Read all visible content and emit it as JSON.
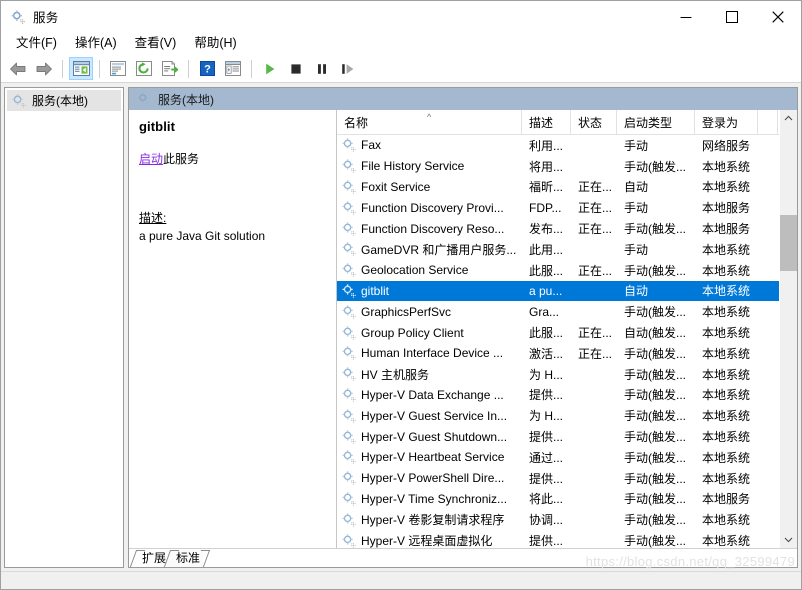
{
  "window": {
    "title": "服务",
    "icon": "services-gear-icon",
    "minimize_label": "—",
    "maximize_label": "□",
    "close_label": "✕"
  },
  "menu": {
    "items": [
      {
        "label": "文件(F)",
        "name": "menu-file"
      },
      {
        "label": "操作(A)",
        "name": "menu-action"
      },
      {
        "label": "查看(V)",
        "name": "menu-view"
      },
      {
        "label": "帮助(H)",
        "name": "menu-help"
      }
    ]
  },
  "toolbar": {
    "buttons": [
      {
        "name": "back-button",
        "icon": "arrow-left-icon"
      },
      {
        "name": "forward-button",
        "icon": "arrow-right-icon"
      },
      {
        "name": "show-hide-tree-button",
        "icon": "show-console-tree-icon",
        "pressed": true
      },
      {
        "name": "properties-button",
        "icon": "properties-icon"
      },
      {
        "name": "refresh-button",
        "icon": "refresh-icon"
      },
      {
        "name": "export-list-button",
        "icon": "export-list-icon"
      },
      {
        "name": "help-button",
        "icon": "help-question-icon"
      },
      {
        "name": "show-action-pane-button",
        "icon": "action-pane-icon"
      },
      {
        "name": "start-service-button",
        "icon": "play-icon"
      },
      {
        "name": "stop-service-button",
        "icon": "stop-icon"
      },
      {
        "name": "pause-service-button",
        "icon": "pause-icon"
      },
      {
        "name": "restart-service-button",
        "icon": "restart-icon"
      }
    ]
  },
  "tree": {
    "root_label": "服务(本地)",
    "root_icon": "services-node-icon"
  },
  "right_pane": {
    "header_label": "服务(本地)",
    "header_icon": "services-node-icon"
  },
  "detail": {
    "service_name": "gitblit",
    "action_link": "启动",
    "action_suffix": "此服务",
    "description_label": "描述:",
    "description_text": "a pure Java Git solution"
  },
  "list": {
    "columns": [
      {
        "label": "名称",
        "name": "column-name",
        "width": 185,
        "sorted": true,
        "sort_arrow": "^"
      },
      {
        "label": "描述",
        "name": "column-description",
        "width": 49
      },
      {
        "label": "状态",
        "name": "column-status",
        "width": 46
      },
      {
        "label": "启动类型",
        "name": "column-startup-type",
        "width": 78
      },
      {
        "label": "登录为",
        "name": "column-log-on-as",
        "width": 63
      },
      {
        "label": "",
        "name": "column-filler",
        "width": 20
      }
    ],
    "rows": [
      {
        "name": "Fax",
        "description": "利用...",
        "status": "",
        "startup": "手动",
        "logon": "网络服务",
        "selected": false
      },
      {
        "name": "File History Service",
        "description": "将用...",
        "status": "",
        "startup": "手动(触发...",
        "logon": "本地系统",
        "selected": false
      },
      {
        "name": "Foxit Service",
        "description": "福昕...",
        "status": "正在...",
        "startup": "自动",
        "logon": "本地系统",
        "selected": false
      },
      {
        "name": "Function Discovery Provi...",
        "description": "FDP...",
        "status": "正在...",
        "startup": "手动",
        "logon": "本地服务",
        "selected": false
      },
      {
        "name": "Function Discovery Reso...",
        "description": "发布...",
        "status": "正在...",
        "startup": "手动(触发...",
        "logon": "本地服务",
        "selected": false
      },
      {
        "name": "GameDVR 和广播用户服务...",
        "description": "此用...",
        "status": "",
        "startup": "手动",
        "logon": "本地系统",
        "selected": false
      },
      {
        "name": "Geolocation Service",
        "description": "此服...",
        "status": "正在...",
        "startup": "手动(触发...",
        "logon": "本地系统",
        "selected": false
      },
      {
        "name": "gitblit",
        "description": "a pu...",
        "status": "",
        "startup": "自动",
        "logon": "本地系统",
        "selected": true
      },
      {
        "name": "GraphicsPerfSvc",
        "description": "Gra...",
        "status": "",
        "startup": "手动(触发...",
        "logon": "本地系统",
        "selected": false
      },
      {
        "name": "Group Policy Client",
        "description": "此服...",
        "status": "正在...",
        "startup": "自动(触发...",
        "logon": "本地系统",
        "selected": false
      },
      {
        "name": "Human Interface Device ...",
        "description": "激活...",
        "status": "正在...",
        "startup": "手动(触发...",
        "logon": "本地系统",
        "selected": false
      },
      {
        "name": "HV 主机服务",
        "description": "为 H...",
        "status": "",
        "startup": "手动(触发...",
        "logon": "本地系统",
        "selected": false
      },
      {
        "name": "Hyper-V Data Exchange ...",
        "description": "提供...",
        "status": "",
        "startup": "手动(触发...",
        "logon": "本地系统",
        "selected": false
      },
      {
        "name": "Hyper-V Guest Service In...",
        "description": "为 H...",
        "status": "",
        "startup": "手动(触发...",
        "logon": "本地系统",
        "selected": false
      },
      {
        "name": "Hyper-V Guest Shutdown...",
        "description": "提供...",
        "status": "",
        "startup": "手动(触发...",
        "logon": "本地系统",
        "selected": false
      },
      {
        "name": "Hyper-V Heartbeat Service",
        "description": "通过...",
        "status": "",
        "startup": "手动(触发...",
        "logon": "本地系统",
        "selected": false
      },
      {
        "name": "Hyper-V PowerShell Dire...",
        "description": "提供...",
        "status": "",
        "startup": "手动(触发...",
        "logon": "本地系统",
        "selected": false
      },
      {
        "name": "Hyper-V Time Synchroniz...",
        "description": "将此...",
        "status": "",
        "startup": "手动(触发...",
        "logon": "本地服务",
        "selected": false
      },
      {
        "name": "Hyper-V 卷影复制请求程序",
        "description": "协调...",
        "status": "",
        "startup": "手动(触发...",
        "logon": "本地系统",
        "selected": false
      },
      {
        "name": "Hyper-V 远程桌面虚拟化",
        "description": "提供...",
        "status": "",
        "startup": "手动(触发...",
        "logon": "本地系统",
        "selected": false
      }
    ]
  },
  "scrollbar": {
    "up_arrow": "^",
    "down_arrow": "v"
  },
  "tabs": [
    {
      "label": "扩展",
      "name": "tab-extended",
      "active": false
    },
    {
      "label": "标准",
      "name": "tab-standard",
      "active": true
    }
  ],
  "watermark": "https://blog.csdn.net/qq_32599479",
  "colors": {
    "selection": "#0078d7",
    "pane_header": "#a4b8d0",
    "link": "#8a2be2",
    "window_bg": "#f0f0f0"
  }
}
